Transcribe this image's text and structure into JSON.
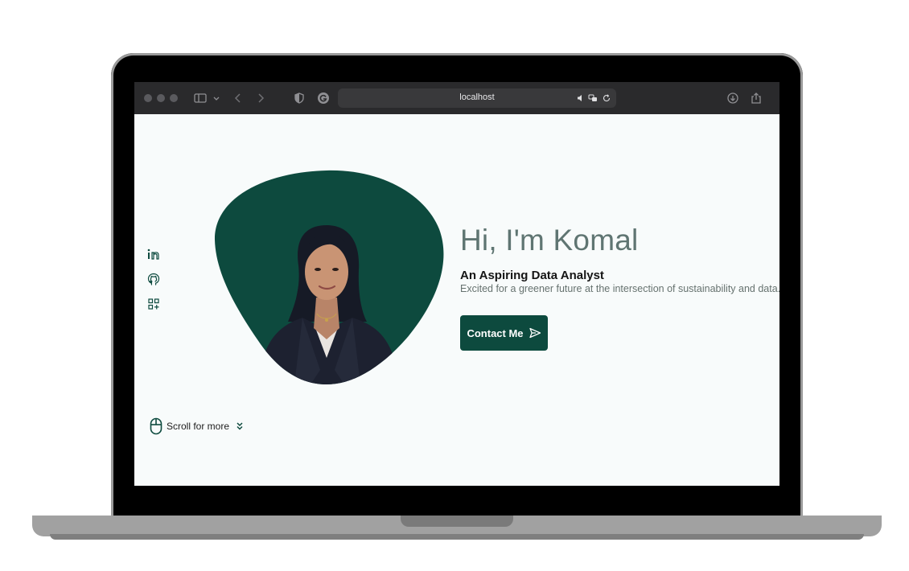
{
  "browser": {
    "url": "localhost",
    "icons": [
      "sidebar-icon",
      "chevron-down-icon",
      "back-icon",
      "forward-icon",
      "shield-icon",
      "g-extension-icon",
      "speaker-icon",
      "translate-icon",
      "reload-icon",
      "download-icon",
      "share-icon"
    ]
  },
  "social": {
    "items": [
      {
        "name": "linkedin",
        "icon": "linkedin-icon"
      },
      {
        "name": "github",
        "icon": "github-icon"
      },
      {
        "name": "grid",
        "icon": "qr-grid-icon"
      }
    ]
  },
  "hero": {
    "title": "Hi, I'm Komal",
    "subtitle": "An Aspiring Data Analyst",
    "description": "Excited for a greener future at the intersection of sustainability and data.",
    "contact_label": "Contact Me",
    "contact_icon": "send-icon"
  },
  "scroll": {
    "label": "Scroll for more",
    "icons": [
      "mouse-icon",
      "double-chevron-down-icon"
    ]
  },
  "colors": {
    "accent": "#0d4a3e",
    "title": "#5f7572",
    "page_bg": "#f8fbfb",
    "browser_bar": "#2a2a2c"
  }
}
